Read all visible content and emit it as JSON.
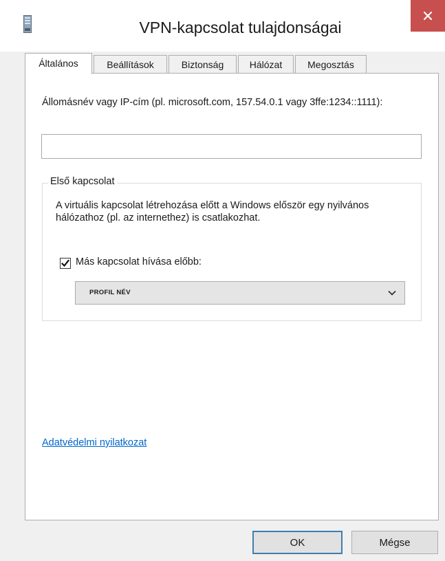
{
  "window": {
    "title": "VPN-kapcsolat tulajdonságai",
    "close_glyph": "✕"
  },
  "tabs": [
    {
      "label": "Általános",
      "active": true
    },
    {
      "label": "Beállítások",
      "active": false
    },
    {
      "label": "Biztonság",
      "active": false
    },
    {
      "label": "Hálózat",
      "active": false
    },
    {
      "label": "Megosztás",
      "active": false
    }
  ],
  "general": {
    "host_label": "Állomásnév vagy IP-cím (pl. microsoft.com, 157.54.0.1 vagy 3ffe:1234::1111):",
    "host_value": "",
    "first_connection": {
      "legend": "Első kapcsolat",
      "description": "A virtuális kapcsolat létrehozása előtt a Windows először egy nyilvános hálózathoz (pl. az internethez) is csatlakozhat.",
      "checkbox_label": "Más kapcsolat hívása előbb:",
      "checkbox_checked": true,
      "select_value": "PROFIL NÉV"
    },
    "privacy_link": "Adatvédelmi nyilatkozat"
  },
  "buttons": {
    "ok": "OK",
    "cancel": "Mégse"
  },
  "colors": {
    "close_button": "#c7504f",
    "link": "#0066cc",
    "default_button_border": "#3c7fb1"
  }
}
